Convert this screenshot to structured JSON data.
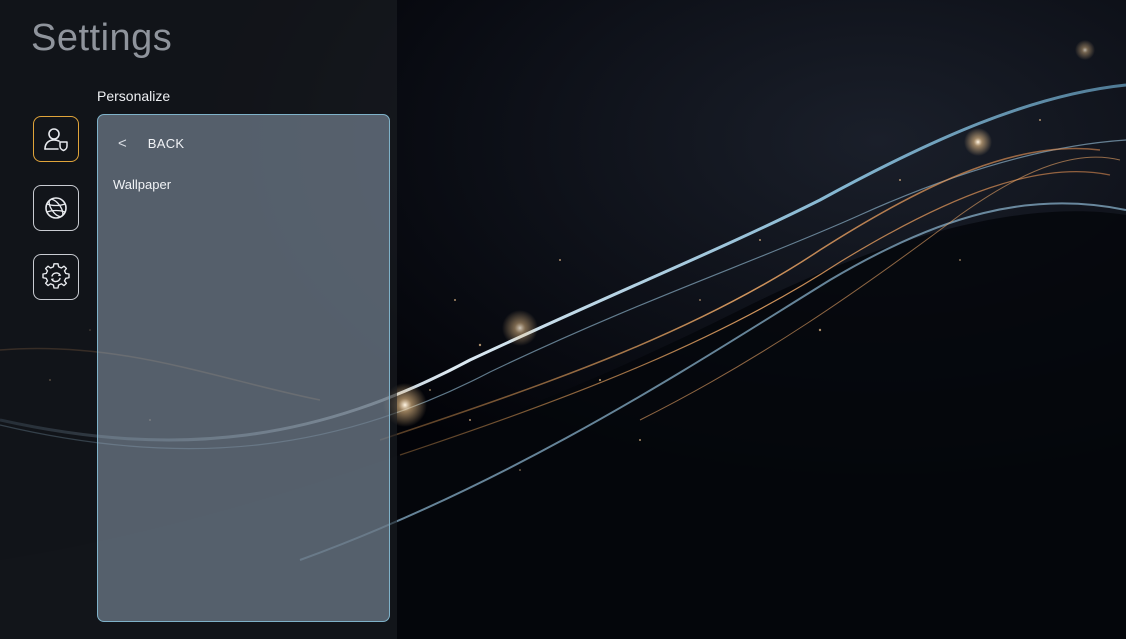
{
  "header": {
    "title": "Settings"
  },
  "section": {
    "title": "Personalize"
  },
  "nav": [
    {
      "icon": "user-badge-icon",
      "active": true
    },
    {
      "icon": "globe-icon",
      "active": false
    },
    {
      "icon": "gear-icon",
      "active": false
    }
  ],
  "menu": {
    "back_icon": "<",
    "back_label": "BACK",
    "items": [
      {
        "label": "Wallpaper"
      }
    ]
  },
  "colors": {
    "accent": "#e0a43a",
    "card_border": "#7fb2c9",
    "title": "#8f949c"
  }
}
